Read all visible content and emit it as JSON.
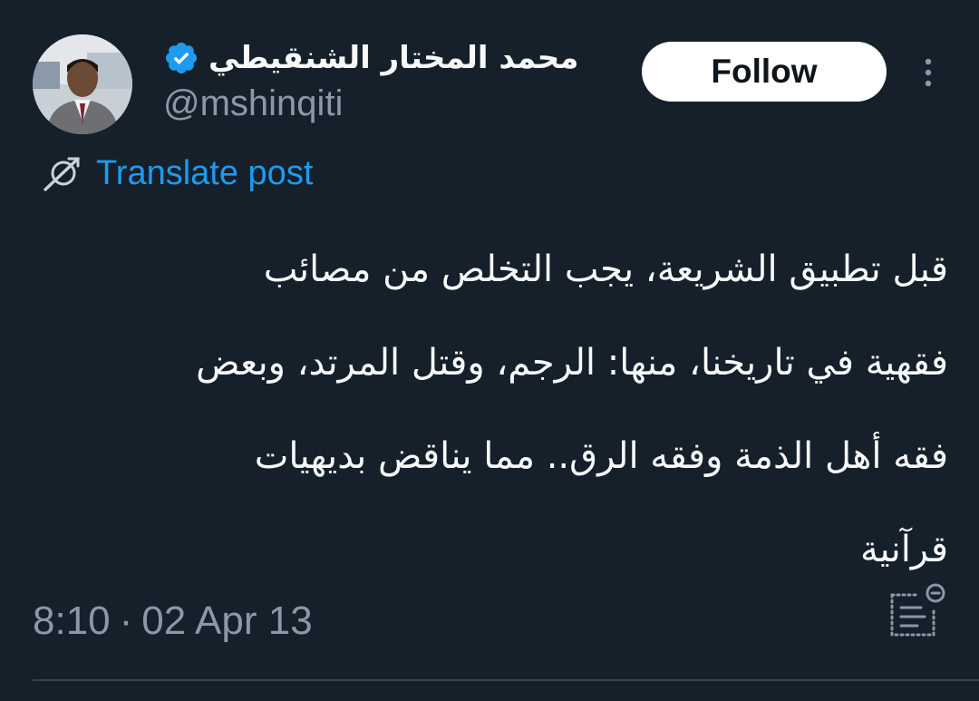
{
  "author": {
    "display_name": "محمد المختار الشنقيطي",
    "handle": "@mshinqiti",
    "verified": true,
    "avatar_icon": "profile-photo"
  },
  "actions": {
    "follow_label": "Follow",
    "more_icon": "more-vertical-icon"
  },
  "translate": {
    "label": "Translate post",
    "icon": "translate-icon"
  },
  "post": {
    "lines": [
      "قبل تطبيق الشريعة، يجب التخلص من مصائب",
      "فقهية في تاريخنا، منها: الرجم، وقتل المرتد، وبعض",
      "فقه أهل الذمة وفقه الرق.. مما يناقض بديهيات",
      "قرآنية"
    ]
  },
  "meta": {
    "time": "8:10",
    "separator": "·",
    "date": "02 Apr 13"
  },
  "colors": {
    "background": "#15202b",
    "text": "#f7f9f9",
    "secondary": "#8b98a5",
    "accent": "#1d9bf0",
    "follow_bg": "#ffffff"
  }
}
